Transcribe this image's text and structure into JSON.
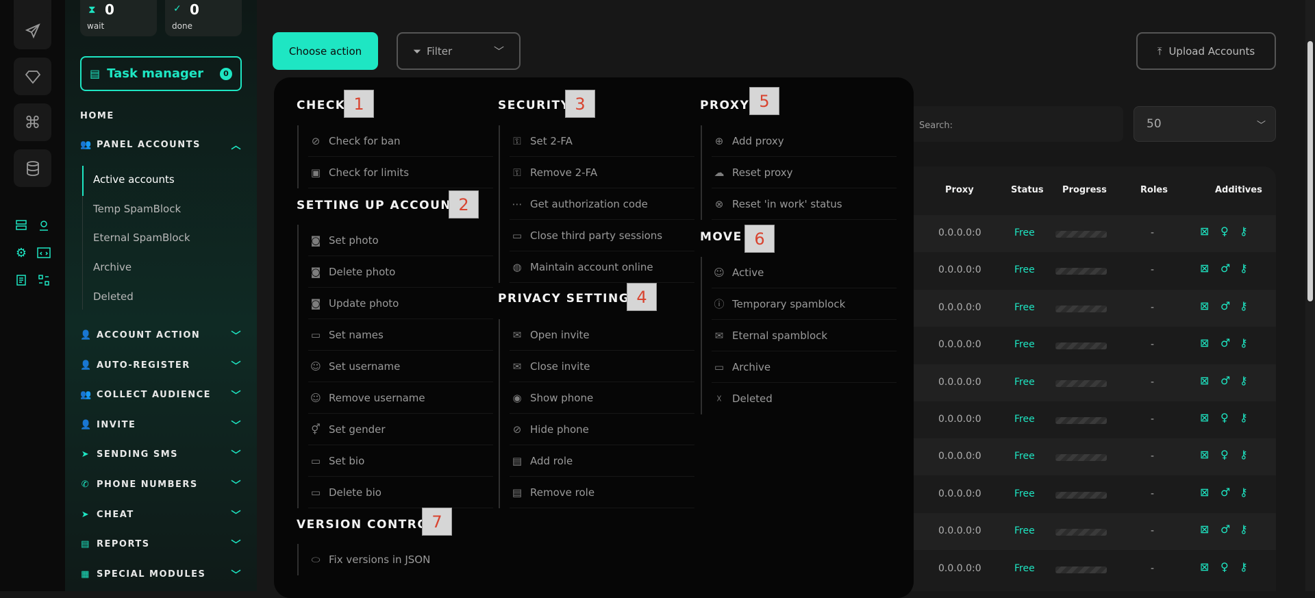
{
  "sidebar": {
    "counters": [
      {
        "value": "0",
        "label": "wait"
      },
      {
        "value": "0",
        "label": "done"
      }
    ],
    "task_manager": {
      "label": "Task manager",
      "badge": "0"
    },
    "home": "HOME",
    "panel_accounts": {
      "label": "PANEL ACCOUNTS",
      "items": [
        "Active accounts",
        "Temp SpamBlock",
        "Eternal SpamBlock",
        "Archive",
        "Deleted"
      ]
    },
    "sections": [
      "ACCOUNT ACTION",
      "AUTO-REGISTER",
      "COLLECT AUDIENCE",
      "INVITE",
      "SENDING SMS",
      "PHONE NUMBERS",
      "CHEAT",
      "REPORTS",
      "SPECIAL MODULES"
    ]
  },
  "toolbar": {
    "choose_action": "Choose action",
    "filter": "Filter",
    "upload": "Upload Accounts",
    "search_label": "Search:",
    "per_page": "50"
  },
  "table": {
    "headers": [
      "Proxy",
      "Status",
      "Progress",
      "Roles",
      "Additives"
    ],
    "rows": [
      {
        "proxy": "0.0.0.0:0",
        "status": "Free",
        "roles": "-",
        "gender": "♀"
      },
      {
        "proxy": "0.0.0.0:0",
        "status": "Free",
        "roles": "-",
        "gender": "♂"
      },
      {
        "proxy": "0.0.0.0:0",
        "status": "Free",
        "roles": "-",
        "gender": "♂"
      },
      {
        "proxy": "0.0.0.0:0",
        "status": "Free",
        "roles": "-",
        "gender": "♂"
      },
      {
        "proxy": "0.0.0.0:0",
        "status": "Free",
        "roles": "-",
        "gender": "♂"
      },
      {
        "proxy": "0.0.0.0:0",
        "status": "Free",
        "roles": "-",
        "gender": "♀"
      },
      {
        "proxy": "0.0.0.0:0",
        "status": "Free",
        "roles": "-",
        "gender": "♀"
      },
      {
        "proxy": "0.0.0.0:0",
        "status": "Free",
        "roles": "-",
        "gender": "♂"
      },
      {
        "proxy": "0.0.0.0:0",
        "status": "Free",
        "roles": "-",
        "gender": "♂"
      },
      {
        "proxy": "0.0.0.0:0",
        "status": "Free",
        "roles": "-",
        "gender": "♀"
      }
    ]
  },
  "menu": {
    "check": {
      "title": "CHECK",
      "num": "1",
      "items": [
        "Check for ban",
        "Check for limits"
      ]
    },
    "setup": {
      "title": "SETTING UP ACCOUNTS",
      "num": "2",
      "items": [
        "Set photo",
        "Delete photo",
        "Update photo",
        "Set names",
        "Set username",
        "Remove username",
        "Set gender",
        "Set bio",
        "Delete bio"
      ]
    },
    "version": {
      "title": "VERSION CONTROL",
      "num": "7",
      "items": [
        "Fix versions in JSON"
      ]
    },
    "security": {
      "title": "SECURITY",
      "num": "3",
      "items": [
        "Set 2-FA",
        "Remove 2-FA",
        "Get authorization code",
        "Close third party sessions",
        "Maintain account online"
      ]
    },
    "privacy": {
      "title": "PRIVACY SETTINGS",
      "num": "4",
      "items": [
        "Open invite",
        "Close invite",
        "Show phone",
        "Hide phone",
        "Add role",
        "Remove role"
      ]
    },
    "proxy": {
      "title": "PROXY",
      "num": "5",
      "items": [
        "Add proxy",
        "Reset proxy",
        "Reset 'in work' status"
      ]
    },
    "move": {
      "title": "MOVE",
      "num": "6",
      "items": [
        "Active",
        "Temporary spamblock",
        "Eternal spamblock",
        "Archive",
        "Deleted"
      ]
    }
  },
  "colors": {
    "accent": "#1ee6c3",
    "background": "#171717",
    "menu": "#060606"
  }
}
